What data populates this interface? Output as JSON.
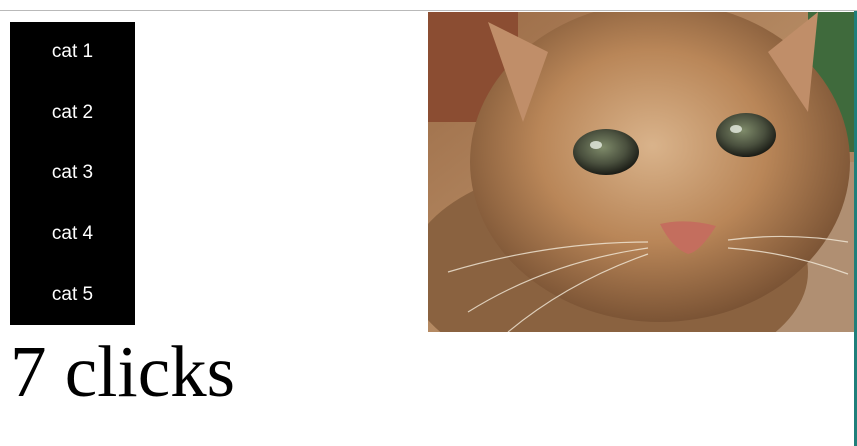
{
  "cat_list": {
    "items": [
      {
        "label": "cat 1"
      },
      {
        "label": "cat 2"
      },
      {
        "label": "cat 3"
      },
      {
        "label": "cat 4"
      },
      {
        "label": "cat 5"
      }
    ]
  },
  "counter": {
    "text": "7 clicks"
  },
  "colors": {
    "menu_background": "#000000",
    "menu_text": "#ffffff",
    "page_background": "#ffffff"
  }
}
